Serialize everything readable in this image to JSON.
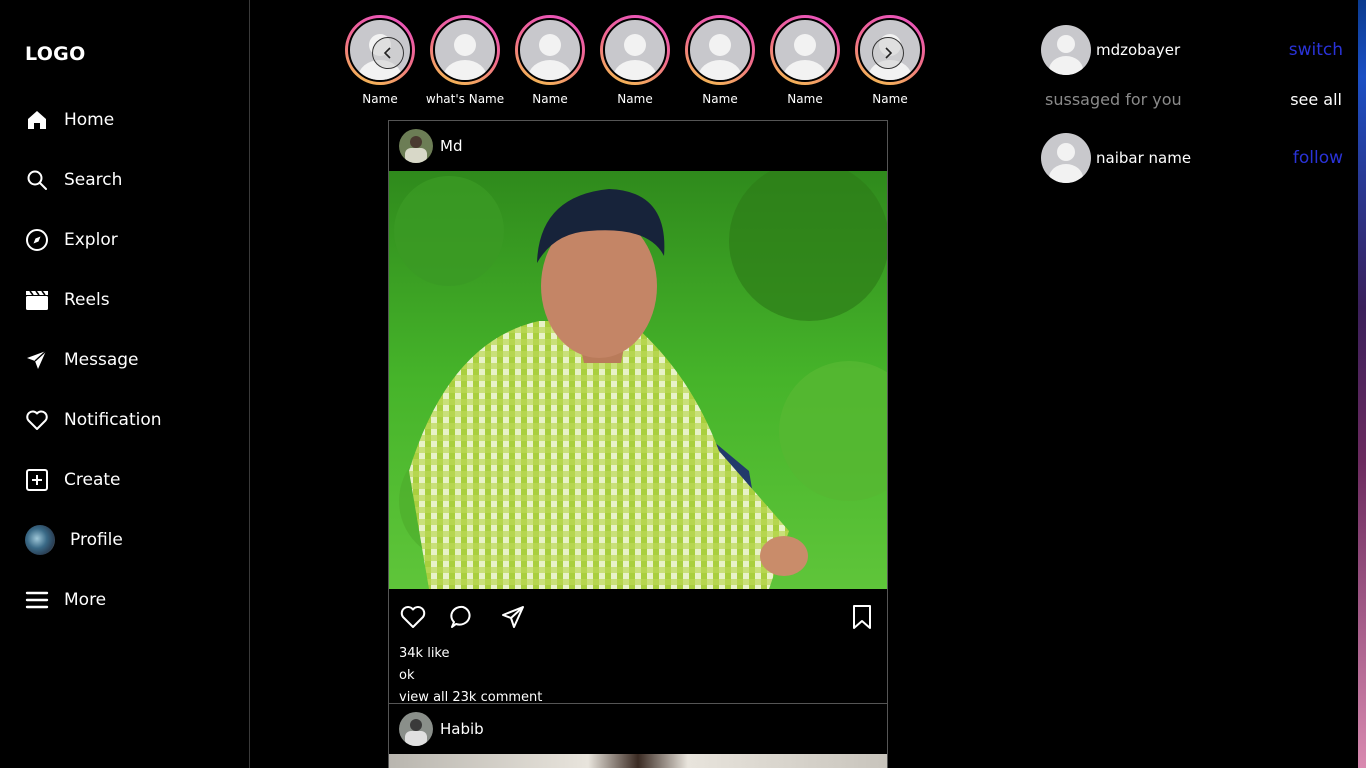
{
  "sidebar": {
    "logo": "LOGO",
    "items": [
      {
        "label": "Home",
        "icon": "home-icon"
      },
      {
        "label": "Search",
        "icon": "search-icon"
      },
      {
        "label": "Explor",
        "icon": "compass-icon"
      },
      {
        "label": "Reels",
        "icon": "clapperboard-icon"
      },
      {
        "label": "Message",
        "icon": "send-icon"
      },
      {
        "label": "Notification",
        "icon": "heart-icon"
      },
      {
        "label": "Create",
        "icon": "plus-square-icon"
      },
      {
        "label": "Profile",
        "icon": "avatar"
      },
      {
        "label": "More",
        "icon": "hamburger-icon"
      }
    ]
  },
  "stories": {
    "names": [
      "Name",
      "what's Name",
      "Name",
      "Name",
      "Name",
      "Name",
      "Name"
    ],
    "prev_icon": "chevron-left-icon",
    "next_icon": "chevron-right-icon"
  },
  "posts": [
    {
      "user": "Md",
      "likes": "34k like",
      "caption": "ok",
      "comments": "view all 23k comment"
    },
    {
      "user": "Habib"
    }
  ],
  "right_panel": {
    "account_name": "mdzobayer",
    "switch_label": "switch",
    "suggested_label": "sussaged for you",
    "see_all_label": "see all",
    "suggestion_name": "naibar name",
    "follow_label": "follow"
  },
  "colors": {
    "background": "#000000",
    "link_blue": "#2a33d8",
    "story_ring_start": "#e94fc4",
    "story_ring_end": "#f6c64a"
  }
}
